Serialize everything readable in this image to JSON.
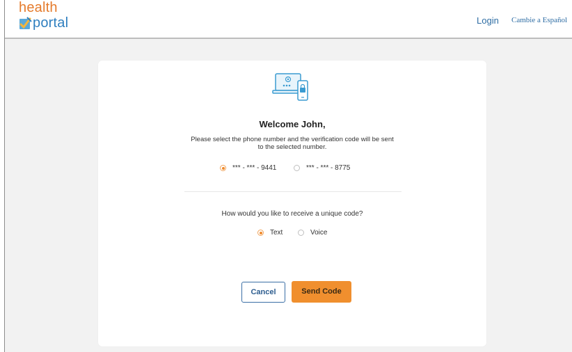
{
  "header": {
    "logo_top": "health",
    "logo_bottom": "portal",
    "login_label": "Login",
    "language_label": "Cambie a Español"
  },
  "card": {
    "welcome": "Welcome  John,",
    "instructions": "Please select the phone number and the verification code will be sent to the selected number.",
    "phone_options": [
      {
        "label": "*** - *** - 9441",
        "selected": true
      },
      {
        "label": "*** - *** - 8775",
        "selected": false
      }
    ],
    "method_question": "How would you like to receive a unique code?",
    "method_options": [
      {
        "label": "Text",
        "selected": true
      },
      {
        "label": "Voice",
        "selected": false
      }
    ],
    "cancel_label": "Cancel",
    "send_label": "Send Code"
  },
  "colors": {
    "accent_orange": "#f08f2e",
    "link_blue": "#2e6da4",
    "logo_orange": "#e57b2c",
    "logo_blue": "#2f7fbf"
  },
  "icons": {
    "logo": "pencil-check-icon",
    "hero": "laptop-phone-lock-icon"
  }
}
